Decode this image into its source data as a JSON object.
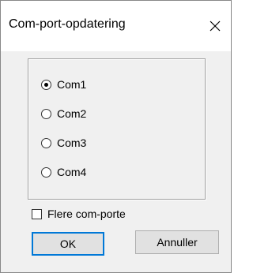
{
  "window": {
    "title": "Com-port-opdatering"
  },
  "ports": {
    "options": [
      {
        "label": "Com1",
        "selected": true
      },
      {
        "label": "Com2",
        "selected": false
      },
      {
        "label": "Com3",
        "selected": false
      },
      {
        "label": "Com4",
        "selected": false
      }
    ]
  },
  "multi_port": {
    "label": "Flere com-porte",
    "checked": false
  },
  "buttons": {
    "ok_label": "OK",
    "cancel_label": "Annuller"
  },
  "icons": {
    "close": "close-icon"
  },
  "colors": {
    "focus_border": "#0078d7",
    "dialog_background": "#f0f0f0",
    "title_background": "#ffffff"
  }
}
